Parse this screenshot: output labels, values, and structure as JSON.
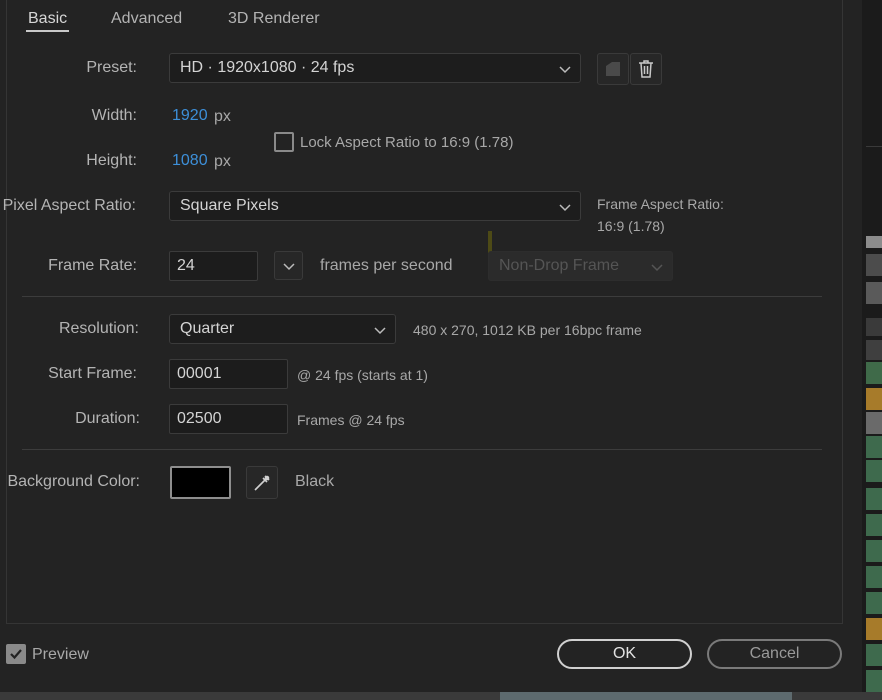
{
  "tabs": [
    {
      "label": "Basic"
    },
    {
      "label": "Advanced"
    },
    {
      "label": "3D Renderer"
    }
  ],
  "preset": {
    "label": "Preset:",
    "value": "HD  ·  1920x1080 · 24 fps"
  },
  "width": {
    "label": "Width:",
    "value": "1920",
    "unit": "px"
  },
  "height": {
    "label": "Height:",
    "value": "1080",
    "unit": "px"
  },
  "lock_aspect": {
    "label": "Lock Aspect Ratio to 16:9 (1.78)",
    "checked": false
  },
  "pixel_aspect": {
    "label": "Pixel Aspect Ratio:",
    "value": "Square Pixels"
  },
  "frame_aspect": {
    "label": "Frame Aspect Ratio:",
    "value": "16:9 (1.78)"
  },
  "frame_rate": {
    "label": "Frame Rate:",
    "value": "24",
    "unit": "frames per second",
    "drop_frame": "Non-Drop Frame"
  },
  "resolution": {
    "label": "Resolution:",
    "value": "Quarter",
    "info": "480 x 270, 1012 KB per 16bpc frame"
  },
  "start_frame": {
    "label": "Start Frame:",
    "value": "00001",
    "info": "@ 24 fps (starts at 1)"
  },
  "duration": {
    "label": "Duration:",
    "value": "02500",
    "info": "Frames @ 24 fps"
  },
  "background": {
    "label": "Background Color:",
    "color": "#000000",
    "name": "Black"
  },
  "preview": {
    "label": "Preview",
    "checked": true
  },
  "buttons": {
    "ok": "OK",
    "cancel": "Cancel"
  },
  "colors": {
    "accent_blue": "#3d8fd8",
    "panel_bg": "#232323"
  }
}
